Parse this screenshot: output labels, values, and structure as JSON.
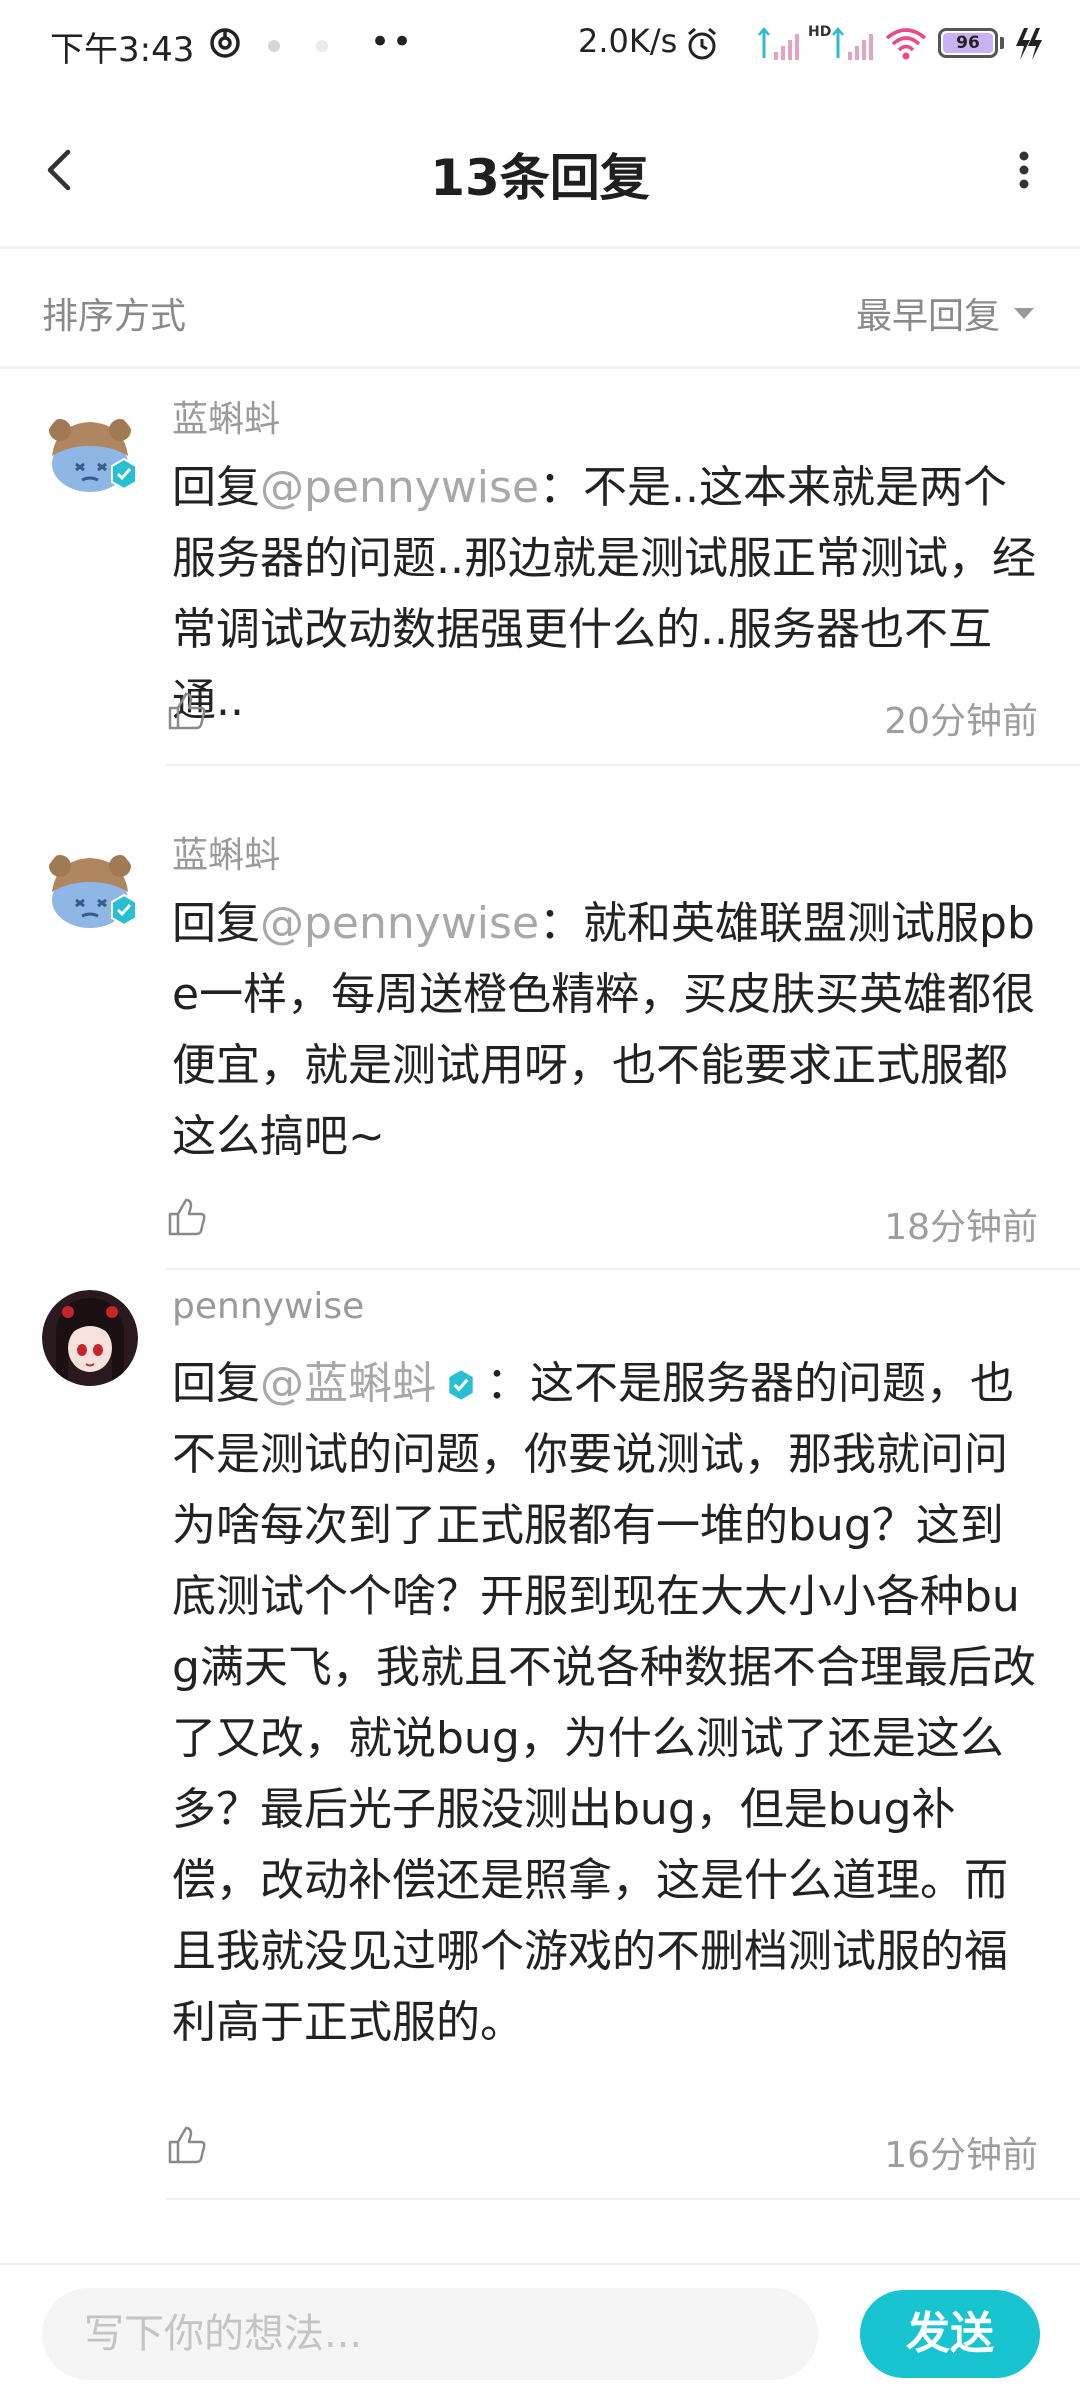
{
  "status_bar": {
    "time": "下午3:43",
    "dots": "••",
    "net_speed": "2.0K/s",
    "hd_label": "HD",
    "battery_level": "96",
    "accent_colors": {
      "signal": "#2fb9d9",
      "wifi": "#e84b8a",
      "battery": "#c9b2f3"
    }
  },
  "header": {
    "title": "13条回复",
    "back_icon": "chevron-left-icon",
    "more_icon": "more-vertical-icon"
  },
  "sort_bar": {
    "label": "排序方式",
    "selected": "最早回复"
  },
  "comments": [
    {
      "username": "蓝蝌蚪",
      "reply_prefix": "回复",
      "mention": "@pennywise",
      "text": "：不是..这本来就是两个服务器的问题..那边就是测试服正常测试，经常调试改动数据强更什么的..服务器也不互通..",
      "time": "20分钟前",
      "verified": true
    },
    {
      "username": "蓝蝌蚪",
      "reply_prefix": "回复",
      "mention": "@pennywise",
      "text": "：就和英雄联盟测试服pbe一样，每周送橙色精粹，买皮肤买英雄都很便宜，就是测试用呀，也不能要求正式服都这么搞吧~",
      "time": "18分钟前",
      "verified": true
    },
    {
      "username": "pennywise",
      "reply_prefix": "回复",
      "mention": "@蓝蝌蚪",
      "text": "：这不是服务器的问题，也不是测试的问题，你要说测试，那我就问问为啥每次到了正式服都有一堆的bug？这到底测试个个啥？开服到现在大大小小各种bug满天飞，我就且不说各种数据不合理最后改了又改，就说bug，为什么测试了还是这么多？最后光子服没测出bug，但是bug补偿，改动补偿还是照拿，这是什么道理。而且我就没见过哪个游戏的不删档测试服的福利高于正式服的。",
      "time": "16分钟前",
      "verified": false
    }
  ],
  "composer": {
    "placeholder": "写下你的想法...",
    "send_label": "发送",
    "send_color": "#18c4cf"
  }
}
